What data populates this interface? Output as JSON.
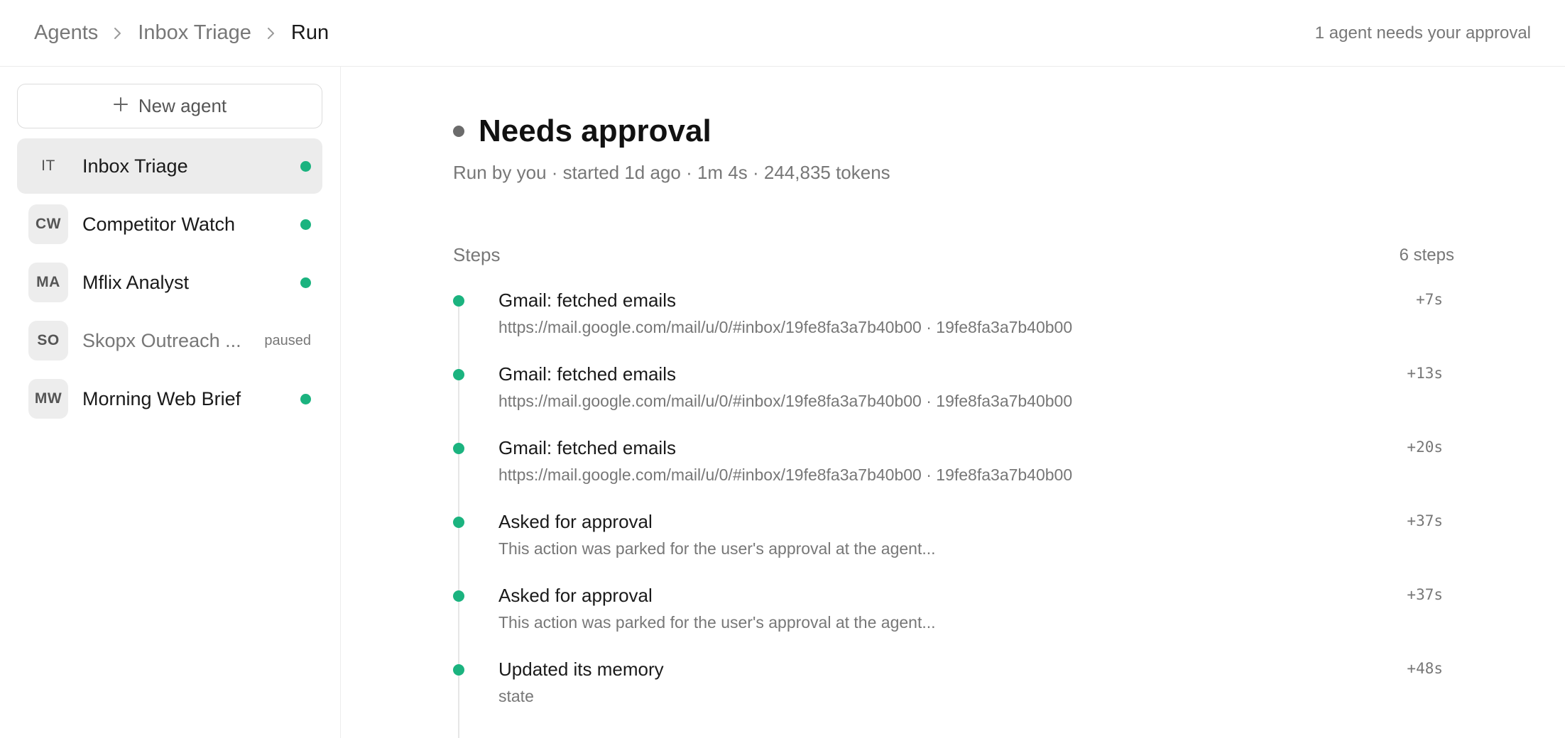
{
  "header": {
    "breadcrumb": [
      "Agents",
      "Inbox Triage",
      "Run"
    ],
    "approval_note": "1 agent needs your approval"
  },
  "sidebar": {
    "new_agent_label": "New agent",
    "agents": [
      {
        "initials": "IT",
        "name": "Inbox Triage",
        "status": "active",
        "active": true
      },
      {
        "initials": "CW",
        "name": "Competitor Watch",
        "status": "active"
      },
      {
        "initials": "MA",
        "name": "Mflix Analyst",
        "status": "active"
      },
      {
        "initials": "SO",
        "name": "Skopx Outreach ...",
        "status_label": "paused"
      },
      {
        "initials": "MW",
        "name": "Morning Web Brief",
        "status": "active"
      }
    ]
  },
  "run": {
    "title": "Needs approval",
    "meta": "Run by you · started 1d ago · 1m 4s · 244,835 tokens",
    "steps_label": "Steps",
    "steps_count": "6 steps",
    "steps": [
      {
        "title": "Gmail: fetched emails",
        "detail": "https://mail.google.com/mail/u/0/#inbox/19fe8fa3a7b40b00 · 19fe8fa3a7b40b00",
        "time": "+7s"
      },
      {
        "title": "Gmail: fetched emails",
        "detail": "https://mail.google.com/mail/u/0/#inbox/19fe8fa3a7b40b00 · 19fe8fa3a7b40b00",
        "time": "+13s"
      },
      {
        "title": "Gmail: fetched emails",
        "detail": "https://mail.google.com/mail/u/0/#inbox/19fe8fa3a7b40b00 · 19fe8fa3a7b40b00",
        "time": "+20s"
      },
      {
        "title": "Asked for approval",
        "detail": "This action was parked for the user's approval at the agent...",
        "time": "+37s"
      },
      {
        "title": "Asked for approval",
        "detail": "This action was parked for the user's approval at the agent...",
        "time": "+37s"
      },
      {
        "title": "Updated its memory",
        "detail": "state",
        "time": "+48s"
      }
    ]
  },
  "colors": {
    "status_green": "#1bb37f",
    "title_dot": "#6b6b6b",
    "active_row": "#ececec"
  }
}
